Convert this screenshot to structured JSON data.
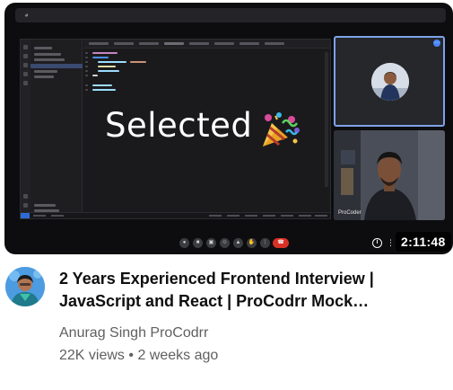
{
  "video": {
    "duration": "2:11:48",
    "overlay_text": "Selected",
    "participant_name": "ProCoder",
    "title_line1": "2 Years Experienced Frontend Interview |",
    "title_line2": "JavaScript and React | ProCodrr Mock…",
    "channel_name": "Anurag Singh ProCodrr",
    "views": "22K views",
    "separator": "•",
    "uploaded": "2 weeks ago"
  },
  "icons": {
    "party_popper": "party-popper-icon",
    "info": "info-icon",
    "more": "more-options-icon",
    "call_controls": [
      "mic-icon",
      "camera-icon",
      "captions-icon",
      "present-icon",
      "screen-share-icon",
      "raise-hand-icon",
      "end-call-icon"
    ]
  },
  "colors": {
    "title": "#0f0f0f",
    "secondary_text": "#606060",
    "end_call": "#d93025",
    "tile_highlight": "#7fa2ea",
    "duration_badge": "#000000"
  }
}
